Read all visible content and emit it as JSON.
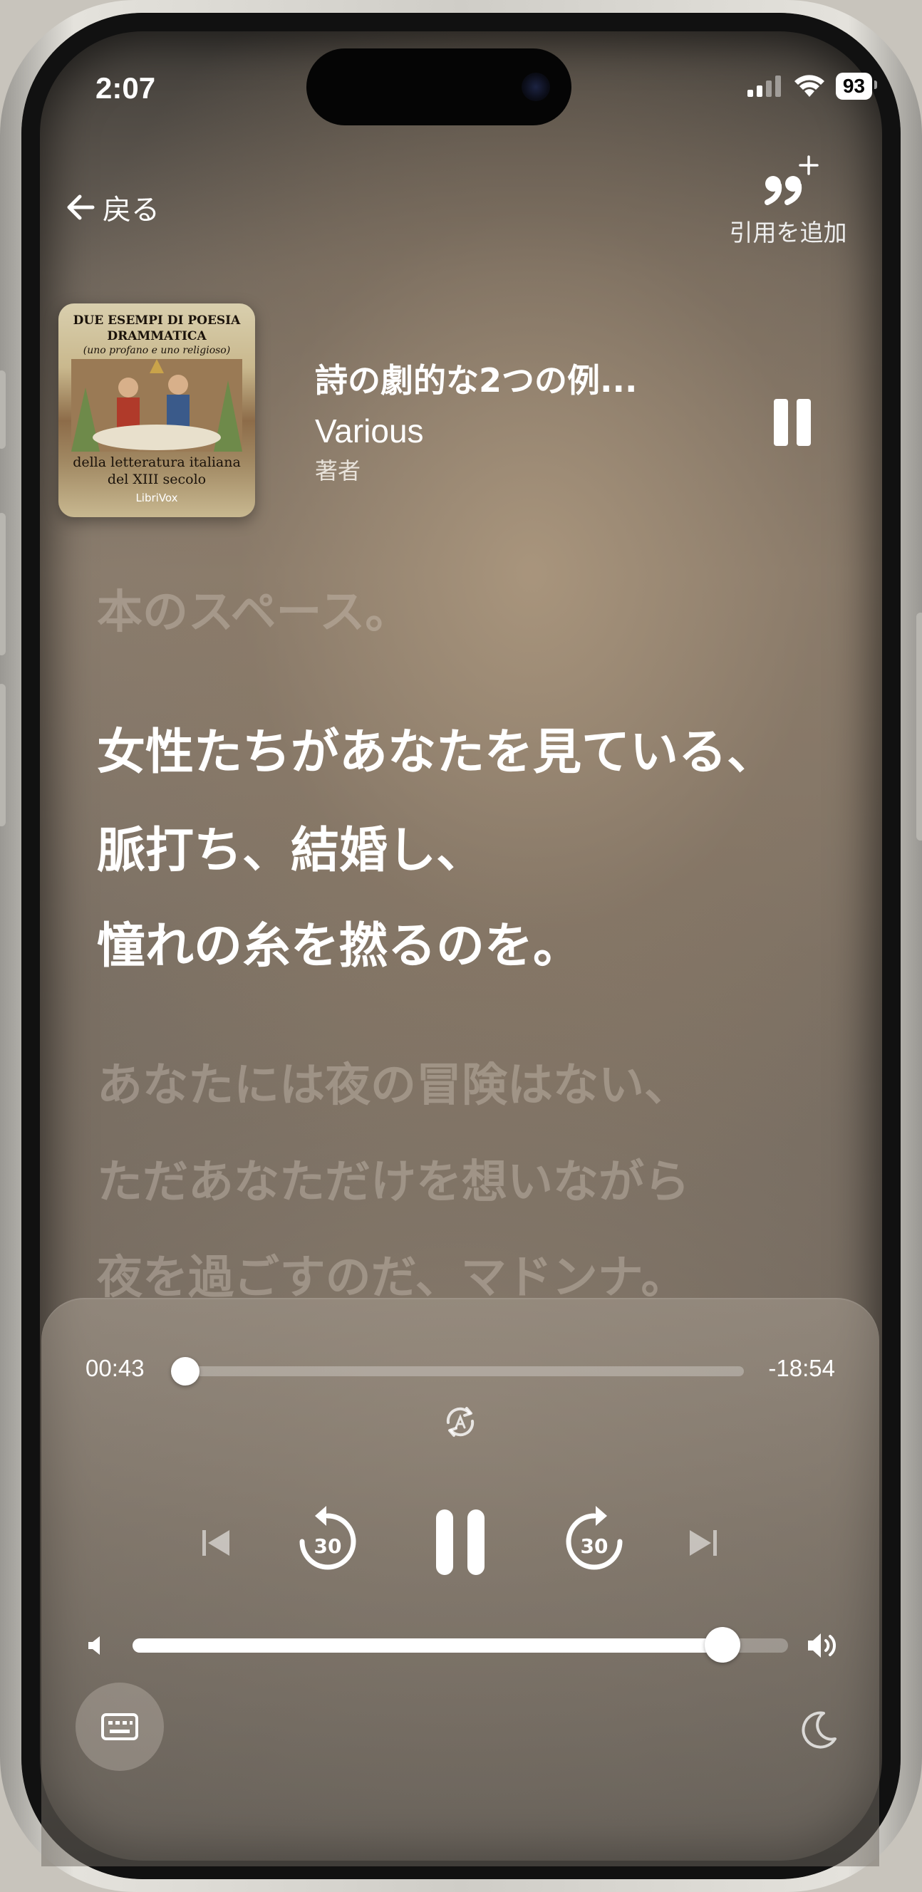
{
  "status_bar": {
    "time": "2:07",
    "battery": "93"
  },
  "nav": {
    "back_label": "戻る",
    "quote_label": "引用を追加"
  },
  "book": {
    "title": "詩の劇的な2つの例...",
    "author": "Various",
    "author_role": "著者",
    "cover": {
      "line1": "DUE ESEMPI DI POESIA",
      "line2": "DRAMMATICA",
      "line3": "(uno profano e uno religioso)",
      "line4": "della letteratura italiana",
      "line5": "del XIII secolo",
      "publisher": "LibriVox"
    }
  },
  "transcript": {
    "previous_line": "本のスペース。",
    "current_lines": [
      "女性たちがあなたを見ている、",
      "脈打ち、結婚し、",
      "憧れの糸を撚るのを。"
    ],
    "next_lines": [
      "あなたには夜の冒険はない、",
      "ただあなただけを想いながら",
      "夜を過ごすのだ、マドンナ。"
    ]
  },
  "playback": {
    "elapsed": "00:43",
    "remaining": "-18:54",
    "progress_fraction": 0.02,
    "skip_back_seconds": "30",
    "skip_forward_seconds": "30",
    "volume_fraction": 0.9
  },
  "icons": {
    "back": "arrow-left-icon",
    "quote": "add-quote-icon",
    "mini_pause": "pause-icon",
    "autoplay": "auto-repeat-icon",
    "prev": "skip-previous-icon",
    "rewind": "rewind-30-icon",
    "play_pause": "pause-icon",
    "forward": "forward-30-icon",
    "next": "skip-next-icon",
    "volume_low": "speaker-low-icon",
    "volume_high": "speaker-high-icon",
    "transcript": "keyboard-transcript-icon",
    "sleep_timer": "moon-icon"
  }
}
